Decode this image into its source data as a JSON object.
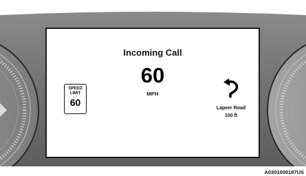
{
  "header": {
    "title": "Incoming Call"
  },
  "speed": {
    "value": "60",
    "unit": "MPH"
  },
  "speed_limit": {
    "line1": "SPEED",
    "line2": "LIMIT",
    "value": "60"
  },
  "navigation": {
    "street": "Lapeer Road",
    "distance": "100 ft",
    "maneuver_icon": "u-turn-left-arrow-icon"
  },
  "footer": {
    "image_code": "A0301000187US"
  },
  "colors": {
    "bezel": "#6e6e6e",
    "dial": "#909090",
    "screen_bg": "#ffffff",
    "screen_border": "#1a1a1a"
  }
}
